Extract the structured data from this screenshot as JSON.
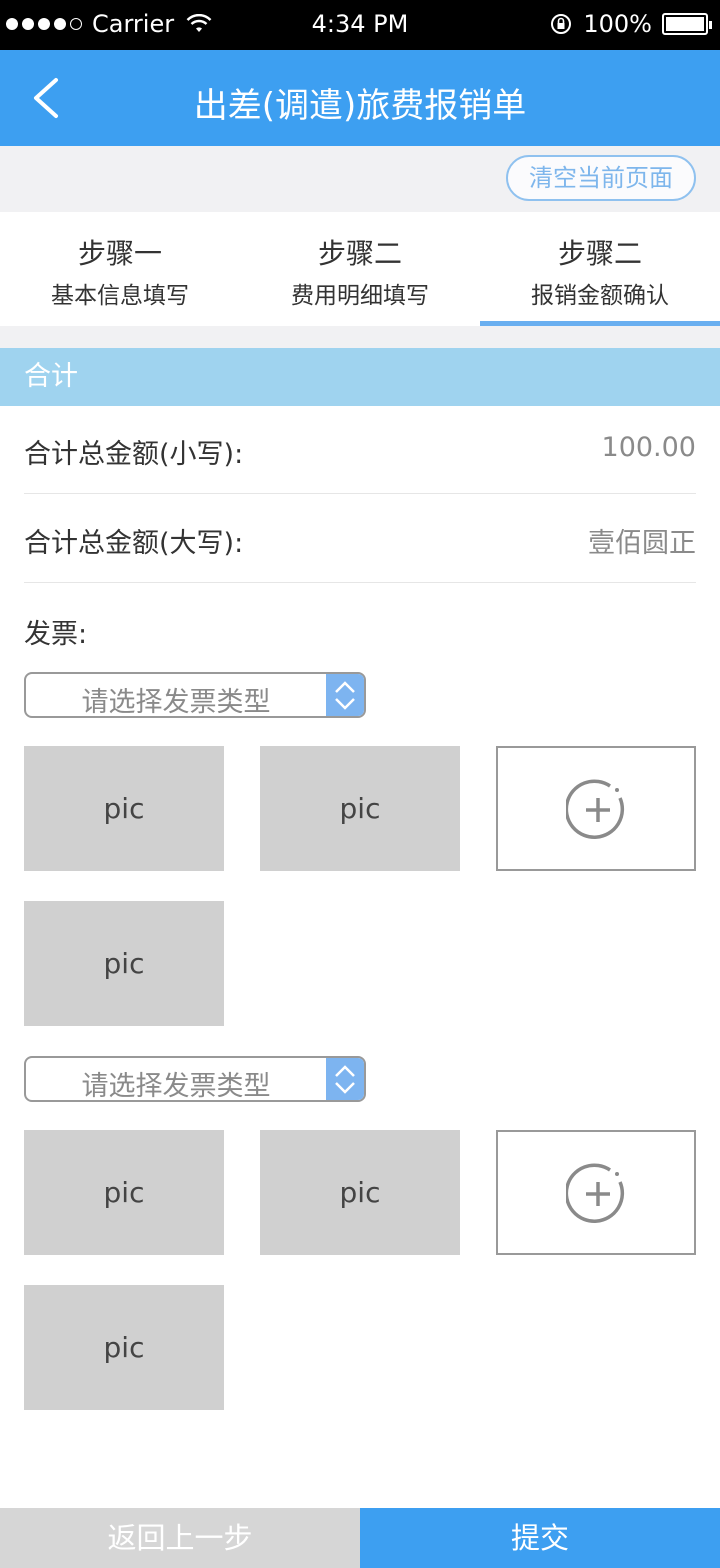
{
  "status_bar": {
    "carrier": "Carrier",
    "time": "4:34 PM",
    "battery": "100%"
  },
  "nav": {
    "title": "出差(调遣)旅费报销单"
  },
  "clear_button": "清空当前页面",
  "steps": [
    {
      "title": "步骤一",
      "subtitle": "基本信息填写"
    },
    {
      "title": "步骤二",
      "subtitle": "费用明细填写"
    },
    {
      "title": "步骤二",
      "subtitle": "报销金额确认"
    }
  ],
  "section_title": "合计",
  "total_small": {
    "label": "合计总金额(小写):",
    "value": "100.00"
  },
  "total_big": {
    "label": "合计总金额(大写):",
    "value": "壹佰圆正"
  },
  "invoice_label": "发票:",
  "invoice_groups": [
    {
      "select_placeholder": "请选择发票类型",
      "pics": [
        "pic",
        "pic",
        "pic"
      ]
    },
    {
      "select_placeholder": "请选择发票类型",
      "pics": [
        "pic",
        "pic",
        "pic"
      ]
    }
  ],
  "footer": {
    "prev": "返回上一步",
    "submit": "提交"
  },
  "colors": {
    "primary": "#3d9ff1",
    "section": "#9fd3ef",
    "select_accent": "#7db4f0"
  }
}
